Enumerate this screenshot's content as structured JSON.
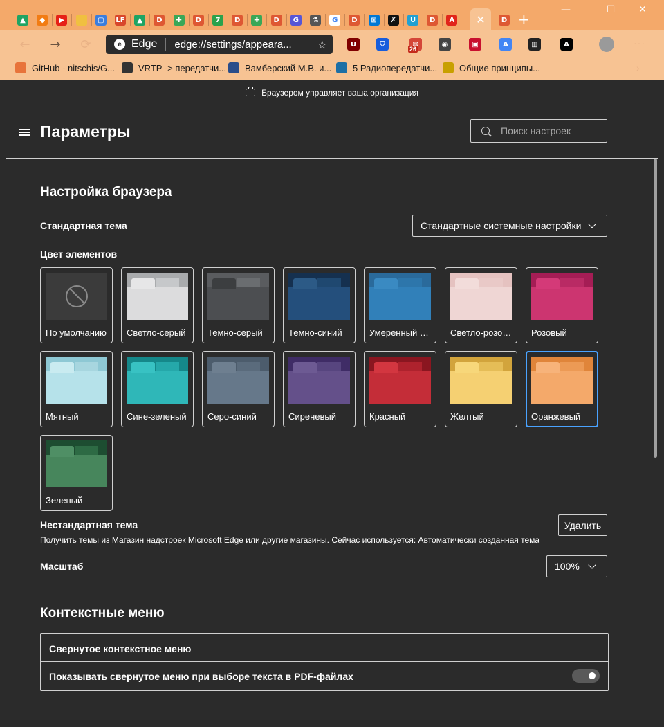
{
  "browser": {
    "tabs": [
      {
        "icon": "google-drive-icon",
        "color": "#1fa463",
        "glyph": "▲"
      },
      {
        "icon": "sourcetree-icon",
        "color": "#f27c13",
        "glyph": "◆"
      },
      {
        "icon": "youtube-icon",
        "color": "#e62117",
        "glyph": "▶"
      },
      {
        "icon": "folder-icon",
        "color": "#f0c040",
        "glyph": ""
      },
      {
        "icon": "chat-icon",
        "color": "#3b7ddd",
        "glyph": "▢"
      },
      {
        "icon": "lf-icon",
        "color": "#d8472b",
        "glyph": "LF"
      },
      {
        "icon": "google-drive-icon",
        "color": "#1fa463",
        "glyph": "▲"
      },
      {
        "icon": "duckduckgo-icon",
        "color": "#de5833",
        "glyph": "D"
      },
      {
        "icon": "puzzle-icon",
        "color": "#3aa757",
        "glyph": "✚"
      },
      {
        "icon": "duckduckgo-icon",
        "color": "#de5833",
        "glyph": "D"
      },
      {
        "icon": "seven-icon",
        "color": "#2ba24c",
        "glyph": "7"
      },
      {
        "icon": "duckduckgo-icon",
        "color": "#de5833",
        "glyph": "D"
      },
      {
        "icon": "puzzle-icon",
        "color": "#3aa757",
        "glyph": "✚"
      },
      {
        "icon": "duckduckgo-icon",
        "color": "#de5833",
        "glyph": "D"
      },
      {
        "icon": "github-icon",
        "color": "#5856d6",
        "glyph": "G"
      },
      {
        "icon": "flask-icon",
        "color": "#555555",
        "glyph": "⚗"
      },
      {
        "icon": "google-icon",
        "color": "#ffffff",
        "glyph": "G"
      },
      {
        "icon": "duckduckgo-icon",
        "color": "#de5833",
        "glyph": "D"
      },
      {
        "icon": "windows-icon",
        "color": "#0078d4",
        "glyph": "⊞"
      },
      {
        "icon": "sketch-icon",
        "color": "#111111",
        "glyph": "✗"
      },
      {
        "icon": "u-icon",
        "color": "#21a0d2",
        "glyph": "U"
      },
      {
        "icon": "duckduckgo-icon",
        "color": "#de5833",
        "glyph": "D"
      },
      {
        "icon": "adobe-icon",
        "color": "#e1251b",
        "glyph": "A"
      }
    ],
    "active_tab_close": "✕",
    "new_tab": "+",
    "window_controls": {
      "minimize": "—",
      "maximize": "☐",
      "close": "✕"
    },
    "nav": {
      "back": "←",
      "forward": "→",
      "refresh": "⟳"
    },
    "omnibox": {
      "site": "Edge",
      "url": "edge://settings/appeara...",
      "favorite_glyph": "☆"
    },
    "extensions": [
      {
        "icon": "ublock-icon",
        "color": "#800000",
        "glyph": "U"
      },
      {
        "icon": "bitwarden-icon",
        "color": "#175ddc",
        "glyph": "⛉"
      },
      {
        "icon": "mail-icon",
        "color": "#d44638",
        "glyph": "✉"
      },
      {
        "icon": "eyes-icon",
        "color": "#444444",
        "glyph": "◉"
      },
      {
        "icon": "book-icon",
        "color": "#c8102e",
        "glyph": "▣"
      },
      {
        "icon": "translate-icon",
        "color": "#4285f4",
        "glyph": "A"
      },
      {
        "icon": "archive-icon",
        "color": "#222222",
        "glyph": "▥"
      },
      {
        "icon": "font-icon",
        "color": "#000000",
        "glyph": "A"
      }
    ],
    "mail_badge": "26",
    "menu": "···",
    "bookmarks": [
      {
        "icon": "github-icon",
        "color": "#e8733a",
        "label": "GitHub - nitschis/G..."
      },
      {
        "icon": "antenna-icon",
        "color": "#333333",
        "label": "VRTP -> передатчи..."
      },
      {
        "icon": "wordpress-icon",
        "color": "#2a4d8a",
        "label": "Вамберский М.В. и..."
      },
      {
        "icon": "s-icon",
        "color": "#1d6fa5",
        "label": "5 Радиопередатчи..."
      },
      {
        "icon": "graduation-icon",
        "color": "#c8a000",
        "label": "Общие принципы..."
      }
    ],
    "bookmarks_more": "›"
  },
  "page": {
    "org_notice": "Браузером управляет ваша организация",
    "title": "Параметры",
    "search_placeholder": "Поиск настроек"
  },
  "appearance": {
    "section_title": "Настройка браузера",
    "default_theme_label": "Стандартная тема",
    "default_theme_value": "Стандартные системные настройки",
    "colors_label": "Цвет элементов",
    "themes": [
      {
        "name": "По умолчанию",
        "top": "#3b3b3b",
        "tab": "#3b3b3b",
        "tab2": "#3b3b3b",
        "body": "#3b3b3b",
        "default": true
      },
      {
        "name": "Светло-серый",
        "top": "#a9abad",
        "tab": "#e6e6e7",
        "tab2": "#c6c8ca",
        "body": "#dcdcdd"
      },
      {
        "name": "Темно-серый",
        "top": "#5a5c5f",
        "tab": "#3c3e40",
        "tab2": "#6a6d70",
        "body": "#4c4e51"
      },
      {
        "name": "Темно-синий",
        "top": "#15304f",
        "tab": "#2c5a86",
        "tab2": "#1f4870",
        "body": "#244f7c"
      },
      {
        "name": "Умеренный си...",
        "top": "#2a6a9b",
        "tab": "#3a8ac2",
        "tab2": "#2d76ab",
        "body": "#3180b9"
      },
      {
        "name": "Светло-розов...",
        "top": "#e5c2c0",
        "tab": "#f2dcda",
        "tab2": "#e9c9c7",
        "body": "#efd6d4"
      },
      {
        "name": "Розовый",
        "top": "#a51d55",
        "tab": "#d43a78",
        "tab2": "#b92a64",
        "body": "#cc3570"
      },
      {
        "name": "Мятный",
        "top": "#8ec8d4",
        "tab": "#c9ebf0",
        "tab2": "#a7d6df",
        "body": "#b6e2ea"
      },
      {
        "name": "Сине-зеленый",
        "top": "#15888a",
        "tab": "#38c2c3",
        "tab2": "#25a8aa",
        "body": "#2fb7b8"
      },
      {
        "name": "Серо-синий",
        "top": "#4c5c6c",
        "tab": "#6e7f90",
        "tab2": "#5a6b7c",
        "body": "#66788a"
      },
      {
        "name": "Сиреневый",
        "top": "#3f2c66",
        "tab": "#6d5a93",
        "tab2": "#57457f",
        "body": "#64508a"
      },
      {
        "name": "Красный",
        "top": "#8a1620",
        "tab": "#d33640",
        "tab2": "#ae222d",
        "body": "#c42d38"
      },
      {
        "name": "Желтый",
        "top": "#d2a43c",
        "tab": "#f7d77a",
        "tab2": "#e5bd57",
        "body": "#f5d072"
      },
      {
        "name": "Оранжевый",
        "top": "#e0853a",
        "tab": "#f7b37a",
        "tab2": "#ec9a55",
        "body": "#f4a96a",
        "selected": true
      },
      {
        "name": "Зеленый",
        "top": "#1d4d31",
        "tab": "#4f8f65",
        "tab2": "#2d6a44",
        "body": "#47865c"
      }
    ],
    "custom_theme_label": "Нестандартная тема",
    "custom_desc_pre": "Получить темы из ",
    "custom_link1": "Магазин надстроек Microsoft Edge",
    "custom_desc_mid": " или ",
    "custom_link2": "другие магазины",
    "custom_desc_post": ". Сейчас используется: Автоматически созданная тема",
    "remove_button": "Удалить",
    "zoom_label": "Масштаб",
    "zoom_value": "100%"
  },
  "context_menus": {
    "section_title": "Контекстные меню",
    "collapsed_label": "Свернутое контекстное меню",
    "pdf_toggle_label": "Показывать свернутое меню при выборе текста в PDF-файлах",
    "pdf_toggle_on": false
  }
}
